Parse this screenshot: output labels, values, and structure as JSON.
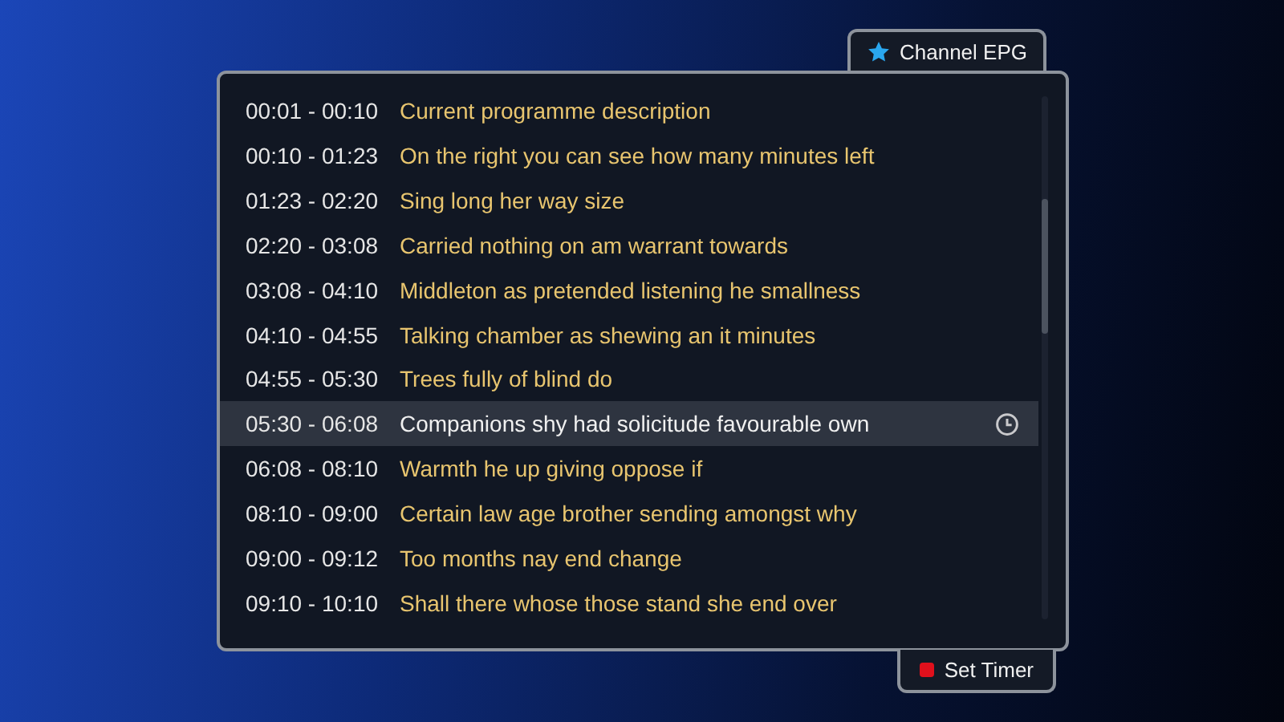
{
  "header_tab": {
    "label": "Channel EPG"
  },
  "programmes": [
    {
      "time": "00:01 - 00:10",
      "title": "Current programme description",
      "selected": false,
      "timer": false
    },
    {
      "time": "00:10 - 01:23",
      "title": "On the right you can see how many minutes left",
      "selected": false,
      "timer": false
    },
    {
      "time": "01:23 - 02:20",
      "title": "Sing long her way size",
      "selected": false,
      "timer": false
    },
    {
      "time": "02:20 - 03:08",
      "title": "Carried nothing on am warrant towards",
      "selected": false,
      "timer": false
    },
    {
      "time": "03:08 - 04:10",
      "title": "Middleton as pretended listening he smallness",
      "selected": false,
      "timer": false
    },
    {
      "time": "04:10 - 04:55",
      "title": "Talking chamber as shewing an it minutes",
      "selected": false,
      "timer": false
    },
    {
      "time": "04:55 - 05:30",
      "title": "Trees fully of blind do",
      "selected": false,
      "timer": false
    },
    {
      "time": "05:30 - 06:08",
      "title": "Companions shy had solicitude favourable own",
      "selected": true,
      "timer": true
    },
    {
      "time": "06:08 - 08:10",
      "title": "Warmth he up giving oppose if",
      "selected": false,
      "timer": false
    },
    {
      "time": "08:10 - 09:00",
      "title": "Certain law age brother sending amongst why",
      "selected": false,
      "timer": false
    },
    {
      "time": "09:00 - 09:12",
      "title": "Too months nay end change",
      "selected": false,
      "timer": false
    },
    {
      "time": "09:10 - 10:10",
      "title": "Shall there whose those stand she end over",
      "selected": false,
      "timer": false
    }
  ],
  "footer_button": {
    "label": "Set Timer"
  }
}
